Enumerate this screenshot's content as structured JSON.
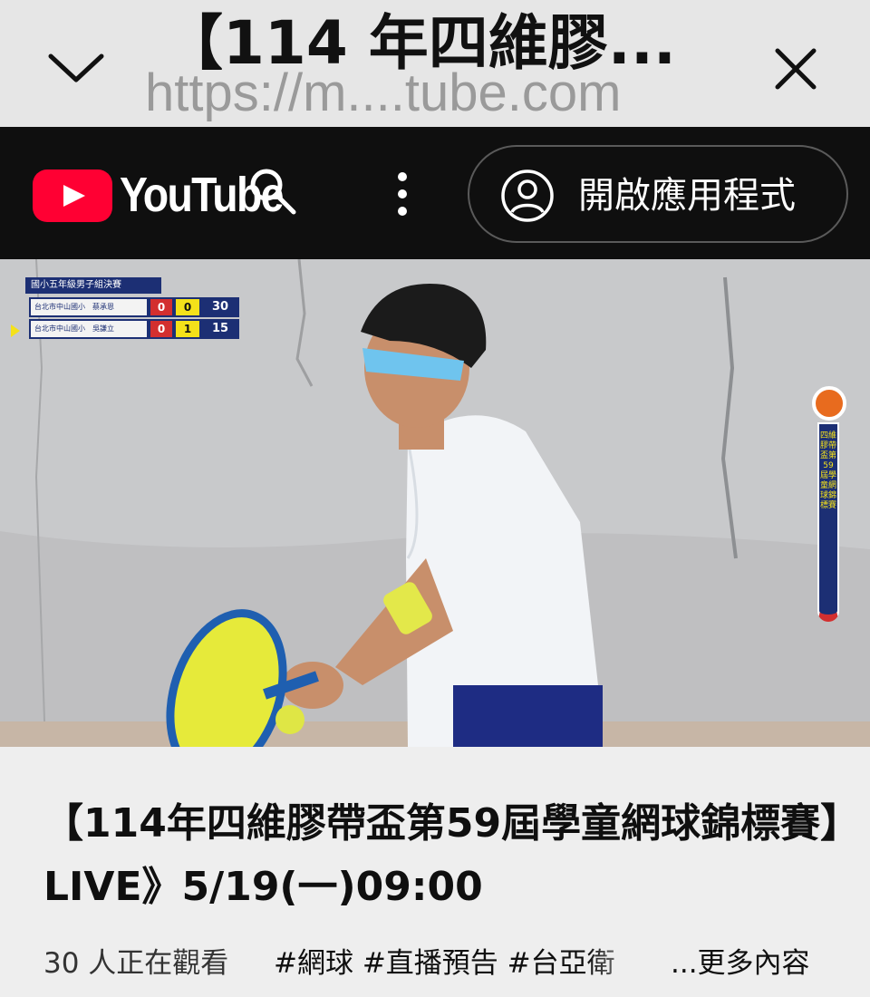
{
  "browser_bar": {
    "title": "【114 年四維膠...",
    "url": "https://m....tube.com"
  },
  "youtube_header": {
    "logo_text": "YouTube",
    "open_app_label": "開啟應用程式"
  },
  "video": {
    "scoreboard": {
      "title": "國小五年級男子組決賽",
      "rows": [
        {
          "name": "台北市中山國小　蔡承恩",
          "sets": "0",
          "games": "0",
          "points": "30"
        },
        {
          "name": "台北市中山國小　吳謙立",
          "sets": "0",
          "games": "1",
          "points": "15"
        }
      ]
    },
    "side_banner_text": "四維膠帶盃第59屆學童網球錦標賽"
  },
  "video_title": "【114年四維膠帶盃第59屆學童網球錦標賽】LIVE》5/19(一)09:00",
  "meta": {
    "views": "30 人正在觀看",
    "tags": "#網球 #直播預告 #台亞衛",
    "more": "...更多內容"
  },
  "colors": {
    "youtube_red": "#ff0033",
    "header_bg": "#0f0f0f",
    "scoreboard_blue": "#1c2f74",
    "scoreboard_red": "#d32f2f",
    "scoreboard_yellow": "#f4e11a"
  }
}
